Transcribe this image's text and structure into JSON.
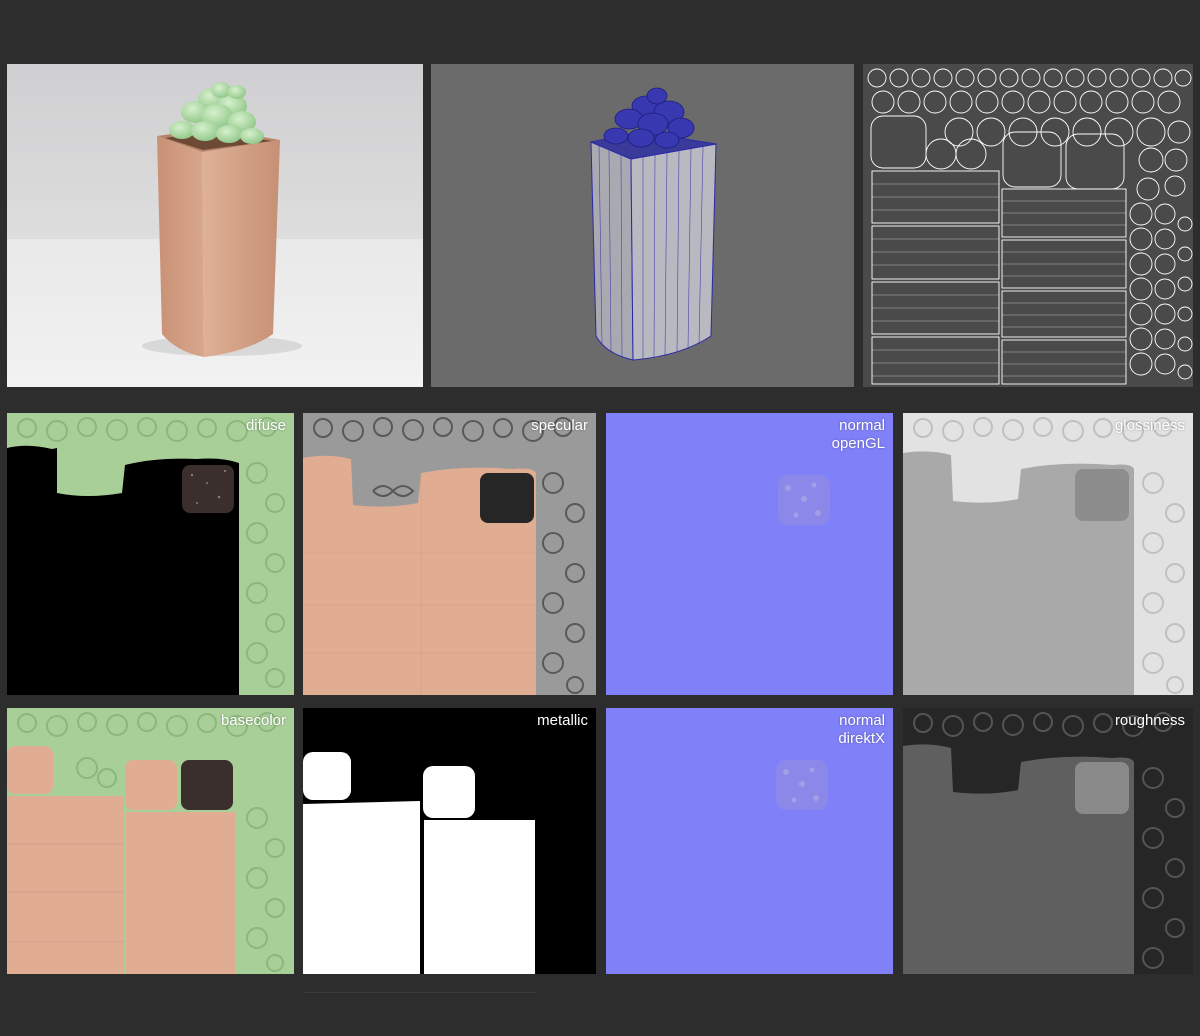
{
  "top_row": {
    "render": {},
    "wireframe": {},
    "uv_layout": {}
  },
  "texture_maps": [
    {
      "id": "difuse",
      "label": "difuse"
    },
    {
      "id": "specular",
      "label": "specular"
    },
    {
      "id": "normal-opengl",
      "label": "normal\nopenGL"
    },
    {
      "id": "glossiness",
      "label": "glossiness"
    },
    {
      "id": "basecolor",
      "label": "basecolor"
    },
    {
      "id": "metallic",
      "label": "metallic"
    },
    {
      "id": "normal-directx",
      "label": "normal\ndirektX"
    },
    {
      "id": "roughness",
      "label": "roughness"
    }
  ],
  "colors": {
    "background": "#2d2d2d",
    "pot": "#d9a88b",
    "succulent": "#a8d8a0",
    "normal_blue": "#8080f8",
    "wire_blue": "#2a2aa8"
  }
}
